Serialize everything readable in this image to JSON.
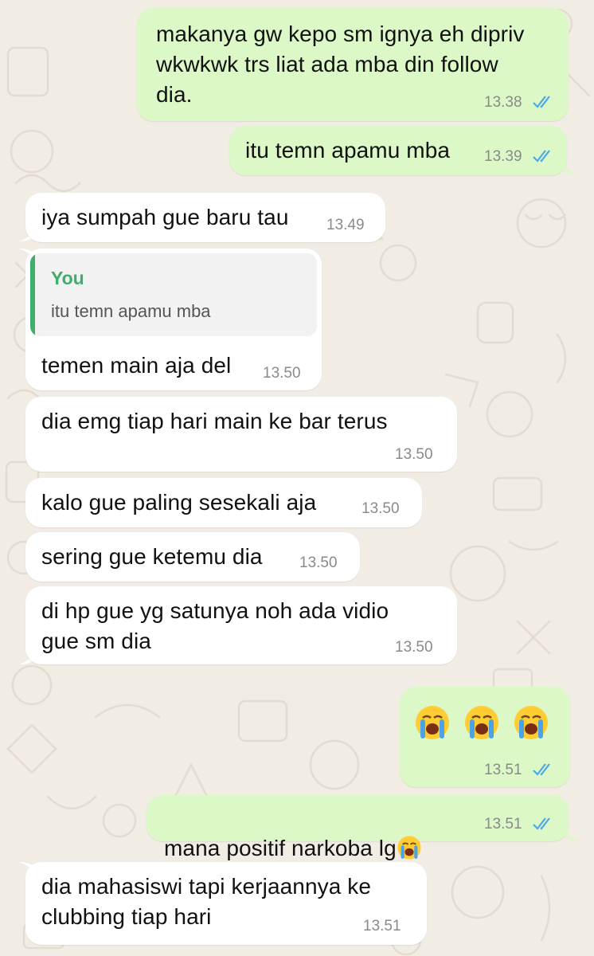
{
  "colors": {
    "outgoing_bubble": "#dcf8c6",
    "incoming_bubble": "#ffffff",
    "read_ticks": "#4fa7e8",
    "quote_accent": "#3eae6a",
    "wallpaper": "#f1ece4"
  },
  "messages": [
    {
      "direction": "outgoing",
      "text": "makanya gw kepo sm ignya eh dipriv\nwkwkwk trs liat ada mba din follow\ndia.",
      "time": "13.38",
      "status": "read"
    },
    {
      "direction": "outgoing",
      "text": "itu temn apamu mba",
      "time": "13.39",
      "status": "read"
    },
    {
      "direction": "incoming",
      "text": "iya sumpah gue baru tau",
      "time": "13.49"
    },
    {
      "direction": "incoming",
      "reply_to": {
        "author": "You",
        "text": "itu temn apamu mba"
      },
      "text": "temen main aja del",
      "time": "13.50"
    },
    {
      "direction": "incoming",
      "text": "dia emg tiap hari main ke bar terus",
      "time": "13.50"
    },
    {
      "direction": "incoming",
      "text": "kalo gue paling sesekali aja",
      "time": "13.50"
    },
    {
      "direction": "incoming",
      "text": "sering gue ketemu dia",
      "time": "13.50"
    },
    {
      "direction": "incoming",
      "text": "di hp gue yg satunya noh ada vidio\ngue sm dia",
      "time": "13.50"
    },
    {
      "direction": "outgoing",
      "emoji": [
        "loudly-crying-face",
        "loudly-crying-face",
        "loudly-crying-face"
      ],
      "time": "13.51",
      "status": "read"
    },
    {
      "direction": "outgoing",
      "text": "mana positif narkoba lg",
      "trailing_emoji": "loudly-crying-face",
      "time": "13.51",
      "status": "read"
    },
    {
      "direction": "incoming",
      "text": "dia mahasiswi tapi kerjaannya ke\nclubbing tiap hari",
      "time": "13.51"
    }
  ]
}
